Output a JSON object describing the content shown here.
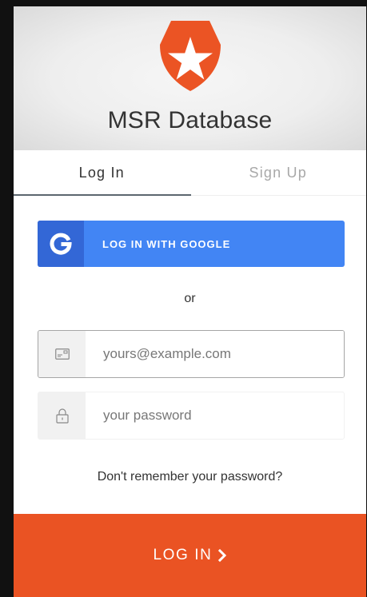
{
  "header": {
    "title": "MSR Database",
    "logo_icon": "auth0-star-shield-icon",
    "brand_color": "#eb5424"
  },
  "tabs": [
    {
      "label": "Log In",
      "active": true
    },
    {
      "label": "Sign Up",
      "active": false
    }
  ],
  "social": {
    "google_label": "LOG IN WITH GOOGLE",
    "google_icon": "google-g-icon",
    "button_color": "#4285f4",
    "icon_bg_color": "#3367d6"
  },
  "separator": "or",
  "form": {
    "email_placeholder": "yours@example.com",
    "email_icon": "envelope-icon",
    "password_placeholder": "your password",
    "password_icon": "lock-icon"
  },
  "forgot_password": "Don't remember your password?",
  "submit": {
    "label": "LOG IN",
    "icon": "chevron-right-icon",
    "color": "#ea5323"
  }
}
